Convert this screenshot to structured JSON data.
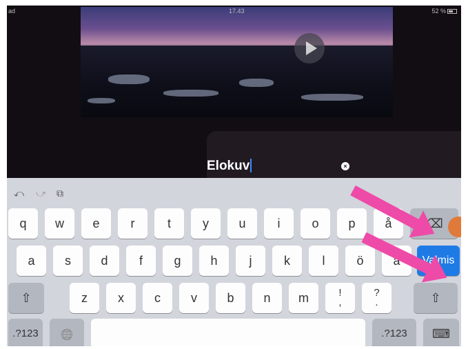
{
  "status_bar": {
    "left": "ad",
    "time": "17.43",
    "battery": "52 %"
  },
  "title_field": {
    "value": "Elokuv"
  },
  "keyboard": {
    "toolbar": {
      "undo": "⤺",
      "redo": "⤻",
      "paste": "⧉"
    },
    "row1": [
      "q",
      "w",
      "e",
      "r",
      "t",
      "y",
      "u",
      "i",
      "o",
      "p",
      "å"
    ],
    "row2": [
      "a",
      "s",
      "d",
      "f",
      "g",
      "h",
      "j",
      "k",
      "l",
      "ö",
      "ä"
    ],
    "row3": [
      "z",
      "x",
      "c",
      "v",
      "b",
      "n",
      "m"
    ],
    "punct1": {
      "top": "!",
      "bottom": ","
    },
    "punct2": {
      "top": "?",
      "bottom": "."
    },
    "done_label": "Valmis",
    "numbers_label": ".?123",
    "backspace_icon": "⌫",
    "shift_icon": "⇧",
    "globe_icon": "🌐",
    "hide_icon": "⌨"
  }
}
